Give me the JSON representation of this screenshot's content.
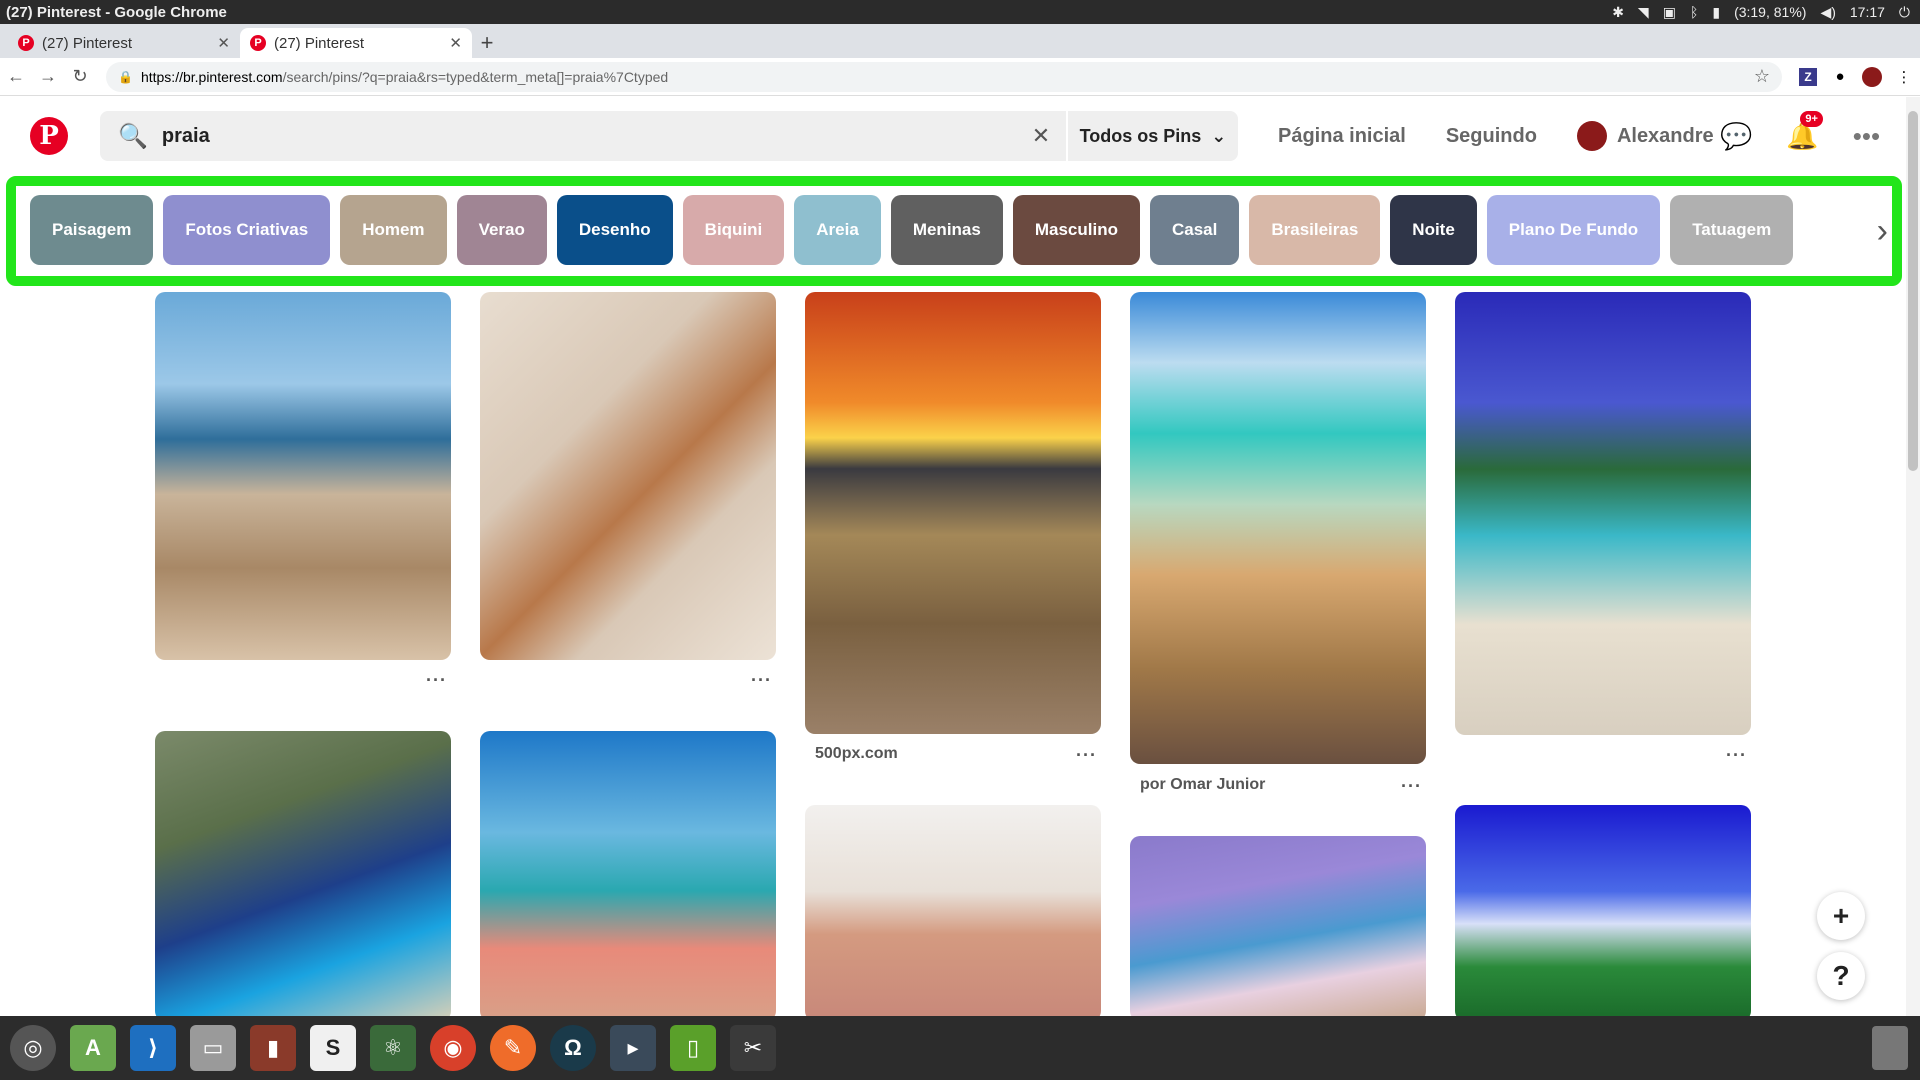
{
  "os": {
    "window_title": "(27) Pinterest - Google Chrome",
    "battery": "(3:19, 81%)",
    "clock": "17:17"
  },
  "browser": {
    "tabs": [
      {
        "label": "(27) Pinterest"
      },
      {
        "label": "(27) Pinterest"
      }
    ],
    "url_host": "https://br.pinterest.com",
    "url_rest": "/search/pins/?q=praia&rs=typed&term_meta[]=praia%7Ctyped"
  },
  "pinterest": {
    "search_value": "praia",
    "filter_label": "Todos os Pins",
    "nav": {
      "home": "Página inicial",
      "following": "Seguindo",
      "user": "Alexandre"
    },
    "notification_badge": "9+"
  },
  "guides": [
    {
      "label": "Paisagem",
      "color": "#6e8b8f"
    },
    {
      "label": "Fotos Criativas",
      "color": "#8f8fcf"
    },
    {
      "label": "Homem",
      "color": "#b5a48f"
    },
    {
      "label": "Verao",
      "color": "#a08594"
    },
    {
      "label": "Desenho",
      "color": "#0a4f8a"
    },
    {
      "label": "Biquini",
      "color": "#d7aaaa"
    },
    {
      "label": "Areia",
      "color": "#8fbfcf"
    },
    {
      "label": "Meninas",
      "color": "#606060"
    },
    {
      "label": "Masculino",
      "color": "#6b4a40"
    },
    {
      "label": "Casal",
      "color": "#6f7f8f"
    },
    {
      "label": "Brasileiras",
      "color": "#d8b8a8"
    },
    {
      "label": "Noite",
      "color": "#2f3548"
    },
    {
      "label": "Plano De Fundo",
      "color": "#a8b0e8"
    },
    {
      "label": "Tatuagem",
      "color": "#b0b0b0"
    }
  ],
  "pins": {
    "p3_caption": "500px.com",
    "p4_caption": "por Omar Junior"
  },
  "floating": {
    "add": "+",
    "help": "?"
  }
}
